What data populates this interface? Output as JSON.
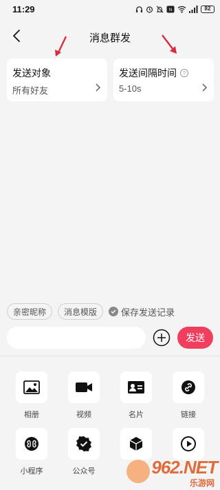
{
  "status_bar": {
    "time": "11:29",
    "battery": "82",
    "icons": [
      "headphones-icon",
      "alarm-icon",
      "bell-icon",
      "nfc-icon",
      "wifi-icon",
      "signal-icon",
      "battery-icon"
    ]
  },
  "header": {
    "title": "消息群发"
  },
  "cards": {
    "target": {
      "title": "发送对象",
      "value": "所有好友"
    },
    "interval": {
      "title": "发送间隔时间",
      "value": "5-10s"
    }
  },
  "chips": {
    "nickname": "亲密昵称",
    "template": "消息模版",
    "save_record": "保存发送记录"
  },
  "composer": {
    "input_value": "",
    "input_placeholder": "",
    "send_label": "发送"
  },
  "tools": [
    {
      "label": "相册",
      "icon": "image-icon"
    },
    {
      "label": "视频",
      "icon": "video-icon"
    },
    {
      "label": "名片",
      "icon": "contact-card-icon"
    },
    {
      "label": "链接",
      "icon": "link-icon"
    },
    {
      "label": "小程序",
      "icon": "mini-program-icon"
    },
    {
      "label": "公众号",
      "icon": "official-account-icon"
    },
    {
      "label": "",
      "icon": "box-icon"
    },
    {
      "label": "",
      "icon": "play-icon"
    }
  ],
  "watermark": {
    "logo": "962.NET",
    "sub": "乐游网"
  },
  "colors": {
    "accent": "#f03e5e",
    "annotation_arrow": "#d62c3c",
    "background": "#f4f4f4"
  }
}
